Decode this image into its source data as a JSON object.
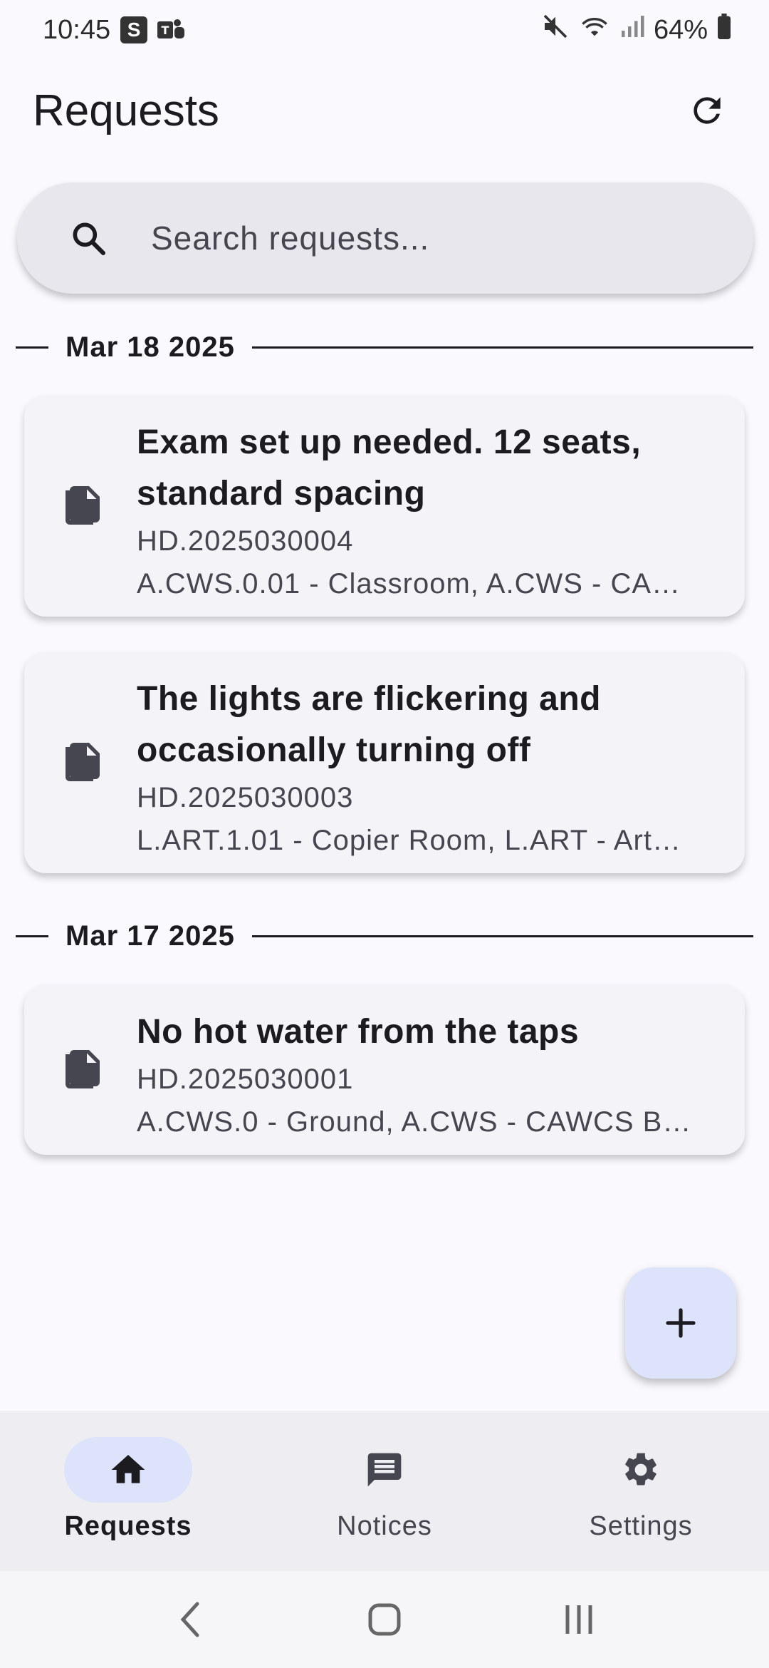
{
  "status_bar": {
    "time": "10:45",
    "app_badge": "S",
    "battery": "64%"
  },
  "header": {
    "title": "Requests",
    "refresh_icon": "refresh-icon"
  },
  "search": {
    "placeholder": "Search requests..."
  },
  "groups": [
    {
      "date": "Mar 18 2025",
      "requests": [
        {
          "title": "Exam set up needed. 12 seats, standard spacing",
          "id": "HD.2025030004",
          "location": "A.CWS.0.01 - Classroom, A.CWS - CA…"
        },
        {
          "title": "The lights are flickering and occasionally turning off",
          "id": "HD.2025030003",
          "location": "L.ART.1.01 - Copier Room, L.ART - Art…"
        }
      ]
    },
    {
      "date": "Mar 17 2025",
      "requests": [
        {
          "title": "No hot water from the taps",
          "id": "HD.2025030001",
          "location": "A.CWS.0 - Ground, A.CWS - CAWCS B…"
        }
      ]
    }
  ],
  "fab": {
    "icon": "plus-icon"
  },
  "bottom_nav": {
    "items": [
      {
        "label": "Requests",
        "icon": "home-icon",
        "active": true
      },
      {
        "label": "Notices",
        "icon": "message-icon",
        "active": false
      },
      {
        "label": "Settings",
        "icon": "gear-icon",
        "active": false
      }
    ]
  },
  "colors": {
    "accent": "#dde3fb",
    "background": "#f9f9fe",
    "card": "#f4f3f8",
    "text": "#1c1b1f"
  }
}
